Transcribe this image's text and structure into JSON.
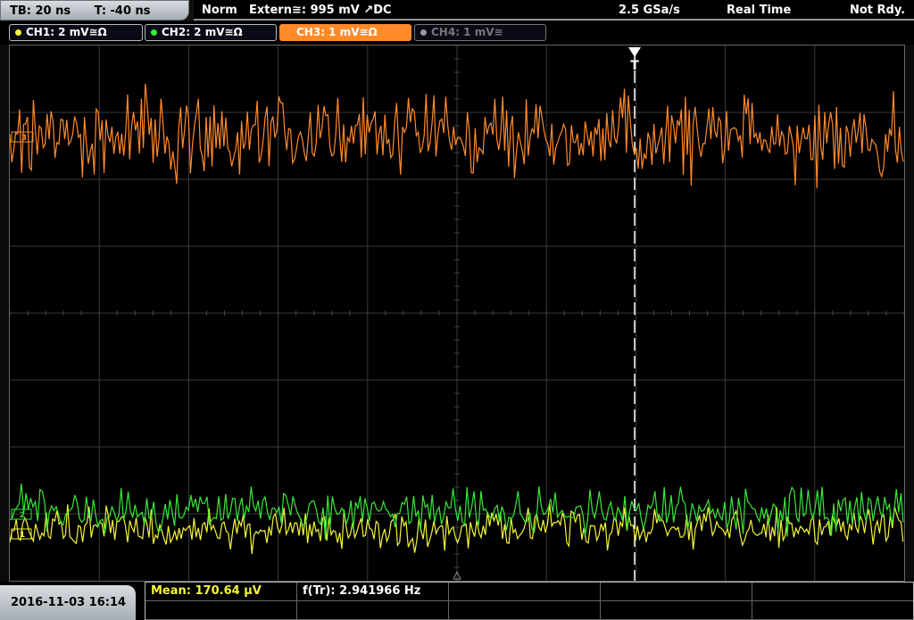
{
  "topbar": {
    "tb": "TB: 20 ns",
    "trig_time": "T: -40 ns",
    "mode": "Norm",
    "trigger": "Extern≅: 995 mV ↗DC",
    "sample_rate": "2.5 GSa/s",
    "acq_mode": "Real Time",
    "status": "Not Rdy."
  },
  "channels": [
    {
      "label": "CH1: 2 mV≅Ω",
      "color": "#f5f53a",
      "active": false
    },
    {
      "label": "CH2: 2 mV≅Ω",
      "color": "#38e838",
      "active": false
    },
    {
      "label": "CH3: 1 mV≅Ω",
      "color": "#ff8a2a",
      "active": true
    },
    {
      "label": "CH4: 1 mV≅",
      "color": "#9a9a9a",
      "active": false
    }
  ],
  "markers": {
    "trigger_label": "T",
    "ch3_marker": "3",
    "ch2_marker": "2",
    "ch1_marker": "1"
  },
  "colors": {
    "ch1": "#f5f53a",
    "ch2": "#38e838",
    "ch3": "#ff8a2a",
    "grid": "#3a3a3a",
    "trigger": "#ffffff"
  },
  "datetime": "2016-11-03 16:14",
  "measurements": {
    "mean": "Mean: 170.64 μV",
    "freq": "f(Tr): 2.941966 Hz"
  }
}
